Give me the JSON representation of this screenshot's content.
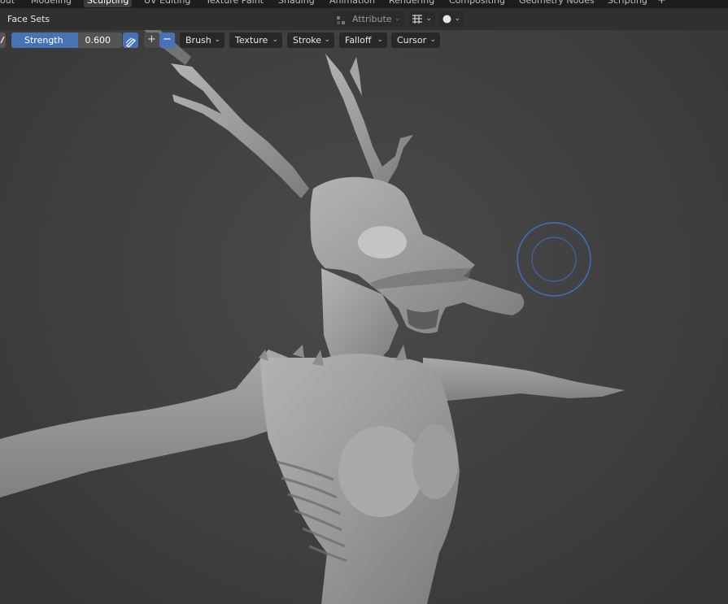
{
  "workspace_tabs": [
    {
      "label": "out",
      "active": false
    },
    {
      "label": "Modeling",
      "active": false
    },
    {
      "label": "Sculpting",
      "active": true
    },
    {
      "label": "UV Editing",
      "active": false
    },
    {
      "label": "Texture Paint",
      "active": false
    },
    {
      "label": "Shading",
      "active": false
    },
    {
      "label": "Animation",
      "active": false
    },
    {
      "label": "Rendering",
      "active": false
    },
    {
      "label": "Compositing",
      "active": false
    },
    {
      "label": "Geometry Nodes",
      "active": false
    },
    {
      "label": "Scripting",
      "active": false
    }
  ],
  "add_workspace": "+",
  "header": {
    "mode_label": "Face Sets",
    "attribute_label": "Attribute"
  },
  "tool_settings": {
    "strength_label": "Strength",
    "strength_value": "0.600",
    "strength_fraction": 0.6,
    "plus_glyph": "+",
    "minus_glyph": "−",
    "menus": [
      "Brush",
      "Texture",
      "Stroke",
      "Falloff",
      "Cursor"
    ]
  },
  "colors": {
    "accent": "#4772b3",
    "brush_cursor": "#3d6fc4",
    "viewport_bg": "#3f3f3f",
    "mesh": "#9b9b9b"
  },
  "icons": {
    "pen": "pen-pressure-icon",
    "overlay": "grid-overlay-icon",
    "shading": "solid-shading-icon"
  }
}
